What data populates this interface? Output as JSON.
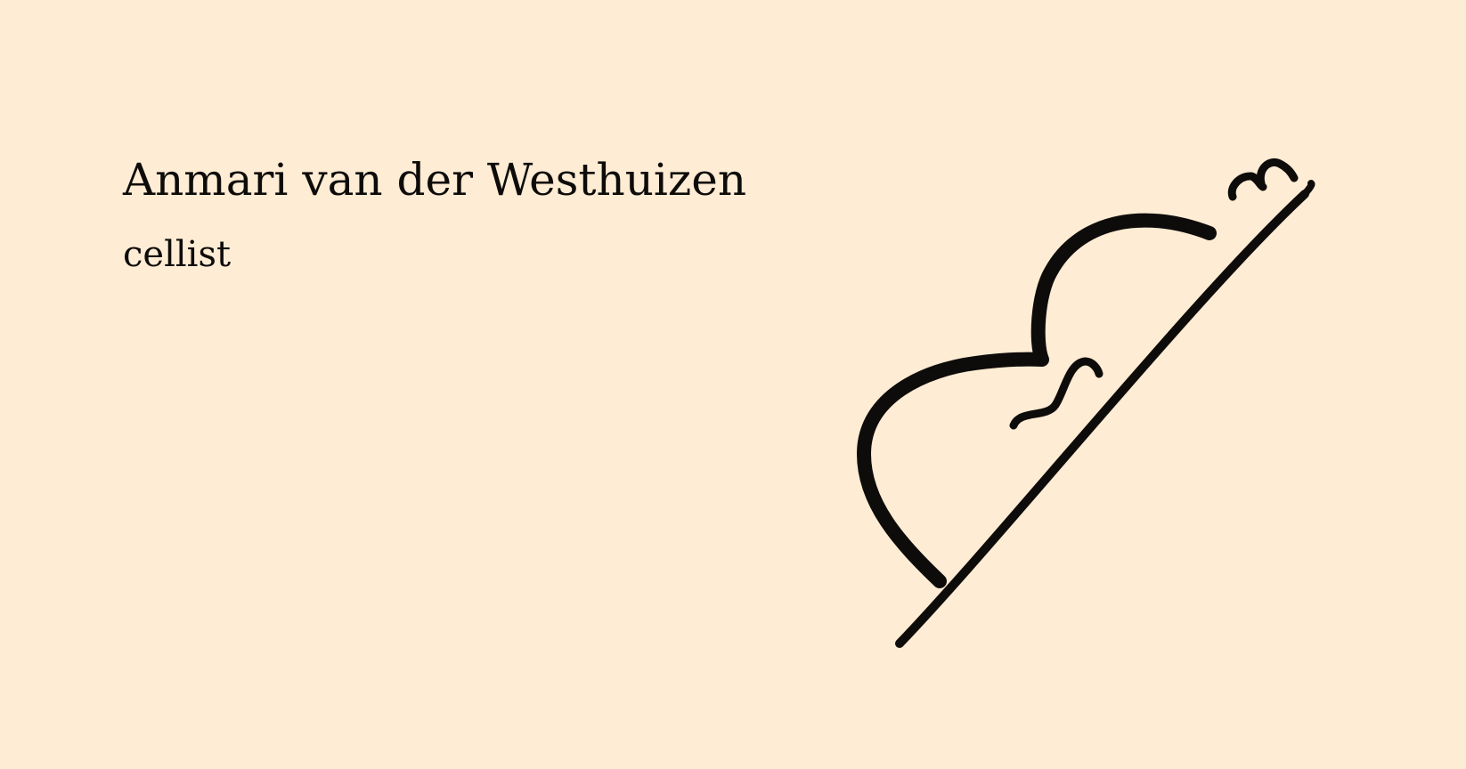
{
  "header": {
    "name": "Anmari van der Westhuizen",
    "role": "cellist"
  },
  "logo": {
    "icon": "cello-icon",
    "color": "#0e0c0a"
  },
  "colors": {
    "background": "#feecd4",
    "text": "#0e0c0a"
  }
}
